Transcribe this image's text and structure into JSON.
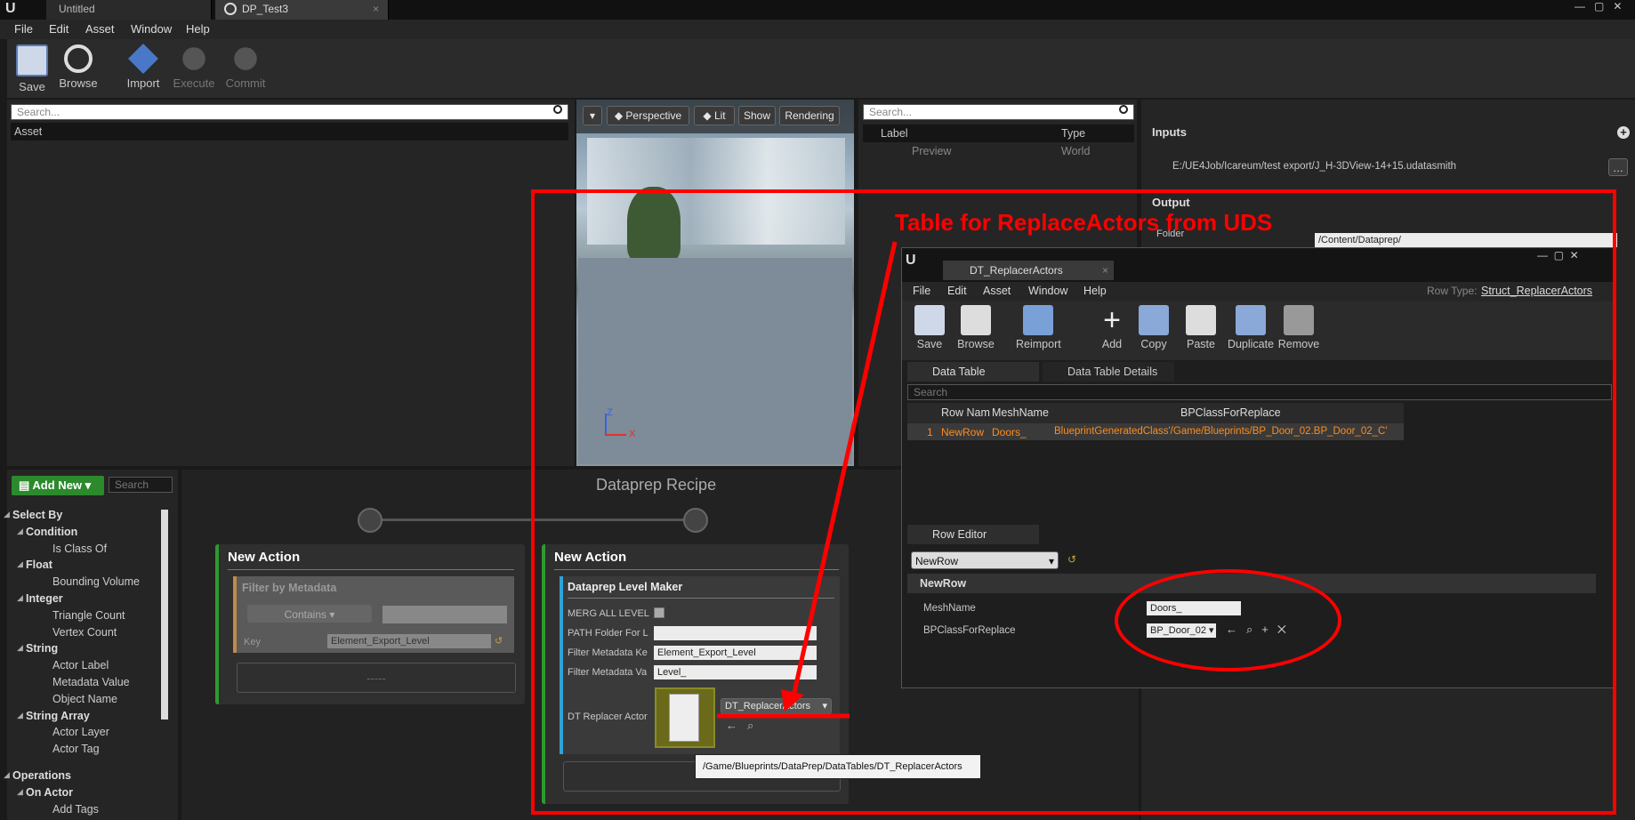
{
  "window": {
    "tabs": [
      {
        "label": "Untitled"
      },
      {
        "label": "DP_Test3"
      }
    ]
  },
  "menu": [
    "File",
    "Edit",
    "Asset",
    "Window",
    "Help"
  ],
  "toolbar": {
    "save": "Save",
    "browse": "Browse",
    "import": "Import",
    "execute": "Execute",
    "commit": "Commit"
  },
  "assets": {
    "search_placeholder": "Search...",
    "column": "Asset"
  },
  "viewport": {
    "perspective": "Perspective",
    "lit": "Lit",
    "show": "Show",
    "rendering": "Rendering",
    "axis_z": "Z",
    "axis_x": "X"
  },
  "scene": {
    "search_placeholder": "Search...",
    "col_label": "Label",
    "col_type": "Type",
    "row_label": "Preview",
    "row_type": "World"
  },
  "inputs": {
    "title": "Inputs",
    "path": "E:/UE4Job/Icareum/test export/J_H-3DView-14+15.udatasmith",
    "output_title": "Output",
    "folder_label": "Folder",
    "folder_value": "/Content/Dataprep/"
  },
  "palette": {
    "add_new": "Add New",
    "search_placeholder": "Search",
    "items": [
      {
        "label": "Select By",
        "bold": true,
        "indent": 0
      },
      {
        "label": "Condition",
        "bold": true,
        "indent": 1
      },
      {
        "label": "Is Class Of",
        "bold": false,
        "indent": 2
      },
      {
        "label": "Float",
        "bold": true,
        "indent": 1
      },
      {
        "label": "Bounding Volume",
        "bold": false,
        "indent": 2
      },
      {
        "label": "Integer",
        "bold": true,
        "indent": 1
      },
      {
        "label": "Triangle Count",
        "bold": false,
        "indent": 2
      },
      {
        "label": "Vertex Count",
        "bold": false,
        "indent": 2
      },
      {
        "label": "String",
        "bold": true,
        "indent": 1
      },
      {
        "label": "Actor Label",
        "bold": false,
        "indent": 2
      },
      {
        "label": "Metadata Value",
        "bold": false,
        "indent": 2
      },
      {
        "label": "Object Name",
        "bold": false,
        "indent": 2
      },
      {
        "label": "String Array",
        "bold": true,
        "indent": 1
      },
      {
        "label": "Actor Layer",
        "bold": false,
        "indent": 2
      },
      {
        "label": "Actor Tag",
        "bold": false,
        "indent": 2
      },
      {
        "label": "Operations",
        "bold": true,
        "indent": 0
      },
      {
        "label": "On Actor",
        "bold": true,
        "indent": 1
      },
      {
        "label": "Add Tags",
        "bold": false,
        "indent": 2
      }
    ]
  },
  "recipe": {
    "title": "Dataprep Recipe",
    "action1": {
      "title": "New Action",
      "filter": "Filter by Metadata",
      "contains": "Contains",
      "key_label": "Key",
      "key_value": "Element_Export_Level",
      "dashes": "-----"
    },
    "action2": {
      "title": "New Action",
      "maker": "Dataprep Level Maker",
      "rows": [
        {
          "label": "MERG ALL LEVELS"
        },
        {
          "label": "PATH Folder For L"
        },
        {
          "label": "Filter Metadata Ke",
          "value": "Element_Export_Level"
        },
        {
          "label": "Filter Metadata Va",
          "value": "Level_"
        }
      ],
      "dt_label": "DT Replacer Actor",
      "dt_value": "DT_ReplacerActors",
      "tooltip": "/Game/Blueprints/DataPrep/DataTables/DT_ReplacerActors"
    }
  },
  "annotation": {
    "text": "Table for ReplaceActors from UDS",
    "color": "#ff0000"
  },
  "dt_window": {
    "tab": "DT_ReplacerActors",
    "menu": [
      "File",
      "Edit",
      "Asset",
      "Window",
      "Help"
    ],
    "row_type_label": "Row Type:",
    "row_type_value": "Struct_ReplacerActors",
    "toolbar": [
      "Save",
      "Browse",
      "Reimport",
      "Add",
      "Copy",
      "Paste",
      "Duplicate",
      "Remove"
    ],
    "tab_table": "Data Table",
    "tab_details": "Data Table Details",
    "search_placeholder": "Search",
    "columns": [
      "Row Nam",
      "MeshName",
      "BPClassForReplace"
    ],
    "row": {
      "index": "1",
      "name": "NewRow",
      "mesh": "Doors_",
      "bp": "BlueprintGeneratedClass'/Game/Blueprints/BP_Door_02.BP_Door_02_C'"
    },
    "row_editor": "Row Editor",
    "row_select": "NewRow",
    "section": "NewRow",
    "mesh_label": "MeshName",
    "mesh_value": "Doors_",
    "bp_label": "BPClassForReplace",
    "bp_value": "BP_Door_02"
  }
}
